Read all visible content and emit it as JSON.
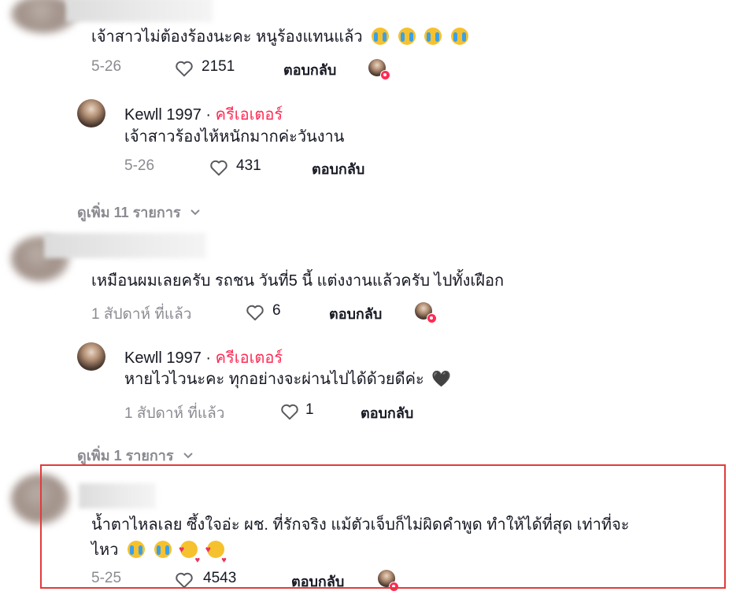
{
  "comments": [
    {
      "text": "เจ้าสาวไม่ต้องร้องนะคะ หนูร้องแทนแล้ว",
      "date": "5-26",
      "likes": "2151",
      "reply_label": "ตอบกลับ",
      "emojis": [
        "loudly-crying-face",
        "loudly-crying-face",
        "loudly-crying-face",
        "loudly-crying-face"
      ],
      "reply": {
        "username": "Kewll 1997",
        "separator": " · ",
        "creator_label": "ครีเอเตอร์",
        "text": "เจ้าสาวร้องไห้หนักมากค่ะวันงาน",
        "date": "5-26",
        "likes": "431",
        "reply_label": "ตอบกลับ"
      },
      "more_replies": "ดูเพิ่ม 11 รายการ"
    },
    {
      "text": "เหมือนผมเลยครับ รถชน วันที่5 นี้ แต่งงานแล้วครับ ไปทั้งเฝือก",
      "date": "1 สัปดาห์ ที่แล้ว",
      "likes": "6",
      "reply_label": "ตอบกลับ",
      "reply": {
        "username": "Kewll 1997",
        "separator": " · ",
        "creator_label": "ครีเอเตอร์",
        "text": "หายไวไวนะคะ ทุกอย่างจะผ่านไปได้ด้วยดีค่ะ",
        "text_emoji": "🖤",
        "date": "1 สัปดาห์ ที่แล้ว",
        "likes": "1",
        "reply_label": "ตอบกลับ"
      },
      "more_replies": "ดูเพิ่ม 1 รายการ"
    },
    {
      "text_line1": "น้ำตาไหลเลย ซึ้งใจอ่ะ ผช. ที่รักจริง แม้ตัวเจ็บก็ไม่ผิดคำพูด ทำให้ได้ที่สุด เท่าที่จะ",
      "text_line2": "ไหว",
      "emojis": [
        "loudly-crying-face",
        "loudly-crying-face",
        "smiling-face-with-hearts",
        "smiling-face-with-hearts"
      ],
      "date": "5-25",
      "likes": "4543",
      "reply_label": "ตอบกลับ",
      "highlighted": true
    }
  ],
  "colors": {
    "creator": "#fe2c55",
    "meta": "#8a8b91",
    "highlight_border": "#e23b3b"
  },
  "icons": {
    "like": "heart-outline-icon",
    "chevron": "chevron-down-icon",
    "liked_by_creator": "creator-heart-badge-icon"
  }
}
